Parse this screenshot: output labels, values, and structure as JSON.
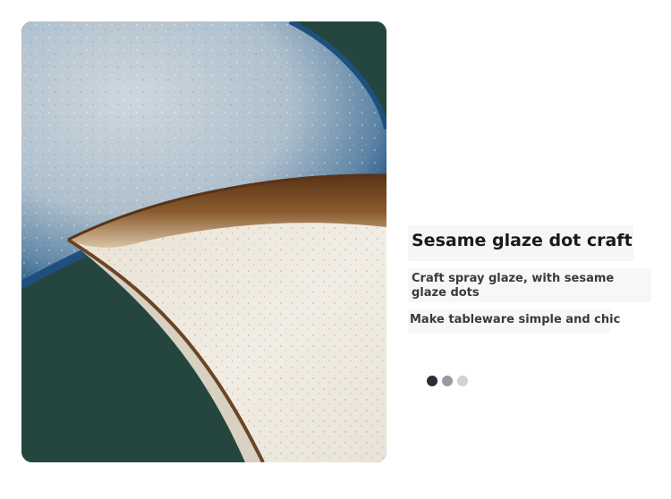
{
  "image": {
    "alt": "Close-up of a blue speckled plate and a brown-rimmed cream plate",
    "colors": {
      "background": "#24463f",
      "blue_glaze": "#9fb4c4",
      "blue_rim": "#1f4f7d",
      "brown_rim": "#7a4a22",
      "cream": "#efeae0"
    }
  },
  "caption": {
    "heading": "Sesame glaze dot craft",
    "description": "Craft spray glaze, with sesame glaze dots",
    "subtext": "Make tableware simple and chic"
  },
  "dots": [
    {
      "name": "dot-1",
      "color": "#2a2d35"
    },
    {
      "name": "dot-2",
      "color": "#9a9aa0"
    },
    {
      "name": "dot-3",
      "color": "#d2d2d6"
    }
  ]
}
